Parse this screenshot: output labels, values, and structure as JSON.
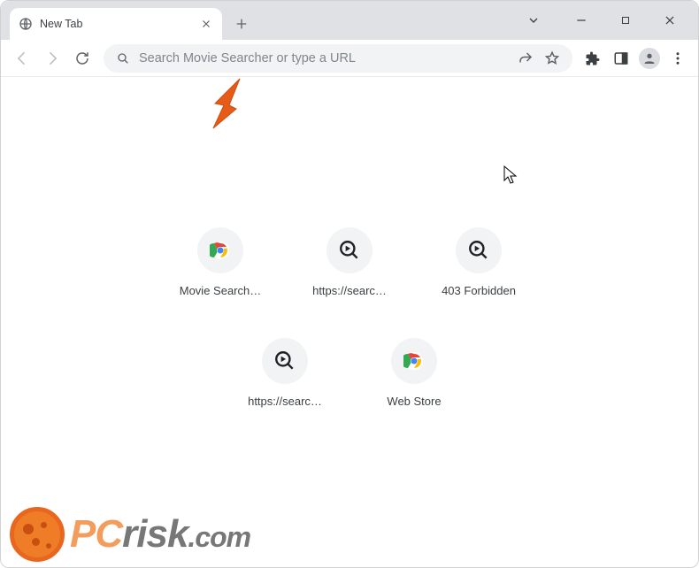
{
  "window": {
    "title": "New Tab"
  },
  "omnibox": {
    "placeholder": "Search Movie Searcher or type a URL"
  },
  "shortcuts": {
    "row1": [
      {
        "label": "Movie Search…",
        "icon": "chrome"
      },
      {
        "label": "https://searc…",
        "icon": "magnify-play"
      },
      {
        "label": "403 Forbidden",
        "icon": "magnify-play"
      }
    ],
    "row2": [
      {
        "label": "https://searc…",
        "icon": "magnify-play"
      },
      {
        "label": "Web Store",
        "icon": "chrome"
      }
    ]
  },
  "watermark": {
    "text_left": "PC",
    "text_right": "risk",
    "tld": ".com"
  },
  "colors": {
    "arrow": "#e75b19",
    "tile_bg": "#f1f3f4",
    "omnibox_bg": "#f1f3f4"
  }
}
